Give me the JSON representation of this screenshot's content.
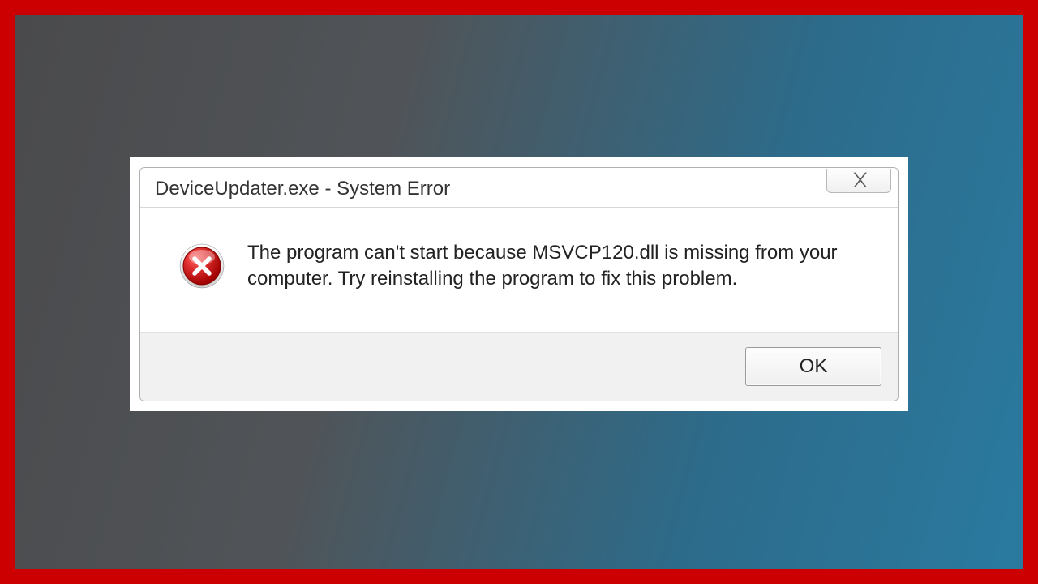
{
  "dialog": {
    "title": "DeviceUpdater.exe - System Error",
    "message": "The program can't start because MSVCP120.dll is missing from your computer. Try reinstalling the program to fix this problem.",
    "ok_label": "OK",
    "close_symbol": "✕"
  }
}
